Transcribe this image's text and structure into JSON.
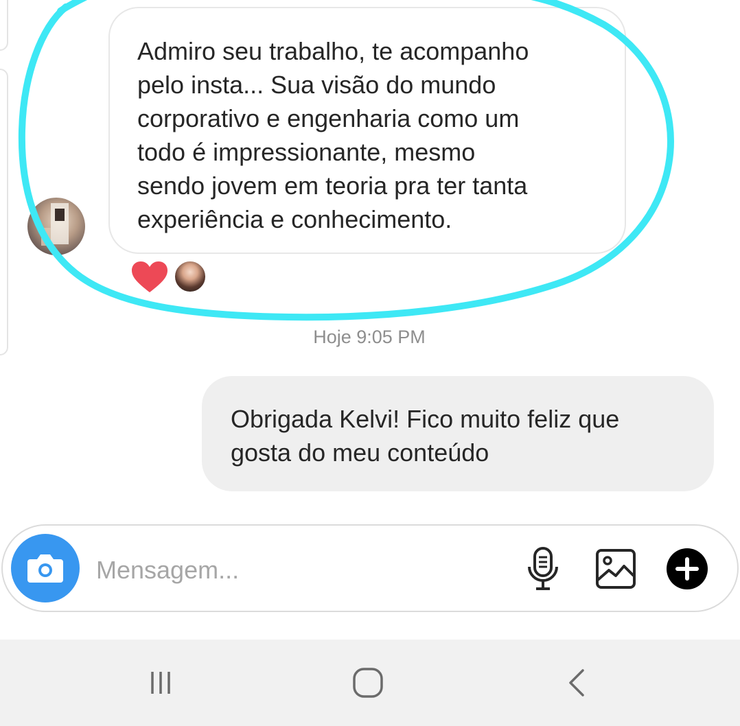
{
  "thread": {
    "incoming_message": {
      "lines": [
        "Admiro seu trabalho, te acompanho",
        "pelo insta... Sua visão do mundo",
        "corporativo e engenharia como um",
        "todo é impressionante, mesmo",
        "sendo jovem em teoria pra ter tanta",
        "experiência e conhecimento."
      ],
      "reactions": [
        "heart",
        "user-avatar"
      ]
    },
    "timestamp": "Hoje 9:05 PM",
    "outgoing_message": {
      "lines": [
        "Obrigada Kelvi! Fico muito feliz que",
        "gosta do meu conteúdo"
      ]
    }
  },
  "composer": {
    "placeholder": "Mensagem...",
    "icons": [
      "camera-icon",
      "microphone-icon",
      "gallery-icon",
      "plus-circle-icon"
    ]
  },
  "system_nav": {
    "icons": [
      "recent-apps-icon",
      "home-icon",
      "back-icon"
    ]
  },
  "colors": {
    "accent": "#3897f0",
    "highlight_stroke": "#3ee8f5",
    "heart": "#ed4956",
    "outgoing_bubble": "#efefef",
    "timestamp": "#8e8e8e"
  }
}
